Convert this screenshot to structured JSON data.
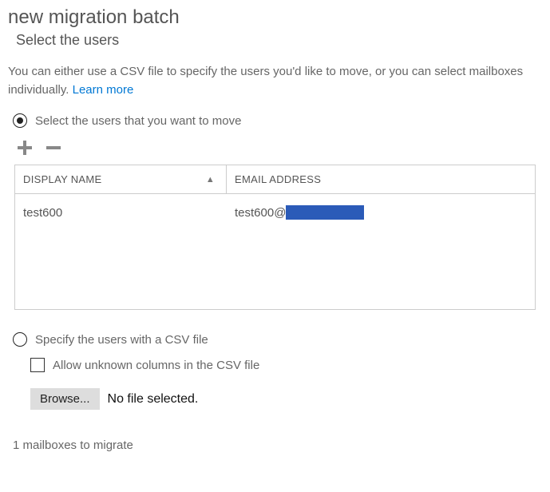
{
  "page": {
    "title": "new migration batch",
    "subtitle": "Select the users"
  },
  "intro": {
    "text_before": "You can either use a CSV file to specify the users you'd like to move, or you can select mailboxes individually. ",
    "learn_more": "Learn more"
  },
  "options": {
    "select_users": {
      "label": "Select the users that you want to move",
      "selected": true
    },
    "csv": {
      "label": "Specify the users with a CSV file",
      "selected": false,
      "allow_unknown_label": "Allow unknown columns in the CSV file",
      "browse_label": "Browse...",
      "file_status": "No file selected."
    }
  },
  "table": {
    "columns": {
      "display_name": "DISPLAY NAME",
      "email": "EMAIL ADDRESS"
    },
    "rows": [
      {
        "display_name": "test600",
        "email_prefix": "test600@"
      }
    ]
  },
  "footer": {
    "status": "1 mailboxes to migrate"
  }
}
